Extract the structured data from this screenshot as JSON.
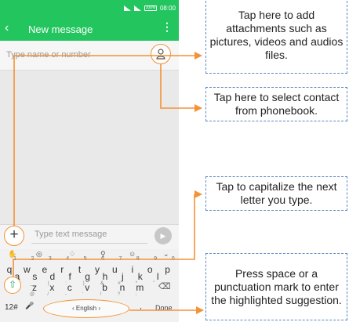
{
  "phone": {
    "status_time": "08:00",
    "battery": "100%",
    "app_title": "New message",
    "to_placeholder": "Type name or number",
    "message_placeholder": "Type text message",
    "colors": {
      "accent": "#22c55e",
      "highlight": "#f39236",
      "callout_border": "#5b88c2"
    }
  },
  "keyboard": {
    "row1": [
      {
        "k": "q",
        "n": "1"
      },
      {
        "k": "w",
        "n": "2"
      },
      {
        "k": "e",
        "n": "3"
      },
      {
        "k": "r",
        "n": "4"
      },
      {
        "k": "t",
        "n": "5"
      },
      {
        "k": "y",
        "n": "6"
      },
      {
        "k": "u",
        "n": "7"
      },
      {
        "k": "i",
        "n": "8"
      },
      {
        "k": "o",
        "n": "9"
      },
      {
        "k": "p",
        "n": "0"
      }
    ],
    "row2": [
      {
        "k": "a",
        "s": "\\"
      },
      {
        "k": "s",
        "s": "_"
      },
      {
        "k": "d",
        "s": "("
      },
      {
        "k": "f",
        "s": ":"
      },
      {
        "k": "g",
        "s": ")"
      },
      {
        "k": "h",
        "s": "&"
      },
      {
        "k": "j",
        "s": "#"
      },
      {
        "k": "k",
        "s": "*"
      },
      {
        "k": "l",
        "s": "\""
      }
    ],
    "row3": [
      {
        "k": "z",
        "s": "@"
      },
      {
        "k": "x",
        "s": "/"
      },
      {
        "k": "c",
        "s": "-"
      },
      {
        "k": "v",
        "s": "'"
      },
      {
        "k": "b",
        "s": "!"
      },
      {
        "k": "n",
        "s": "?"
      },
      {
        "k": "m",
        "s": ";"
      }
    ],
    "numbers_key": "12#",
    "space_label": "English",
    "comma": ",",
    "done_key": "Done"
  },
  "callouts": {
    "attachments": "Tap here to add attachments such as pictures, videos and audios files.",
    "contact": "Tap here to select contact from phonebook.",
    "capitalize": "Tap to capitalize the next letter you type.",
    "space": "Press space or a punctuation mark to enter the highlighted suggestion."
  }
}
